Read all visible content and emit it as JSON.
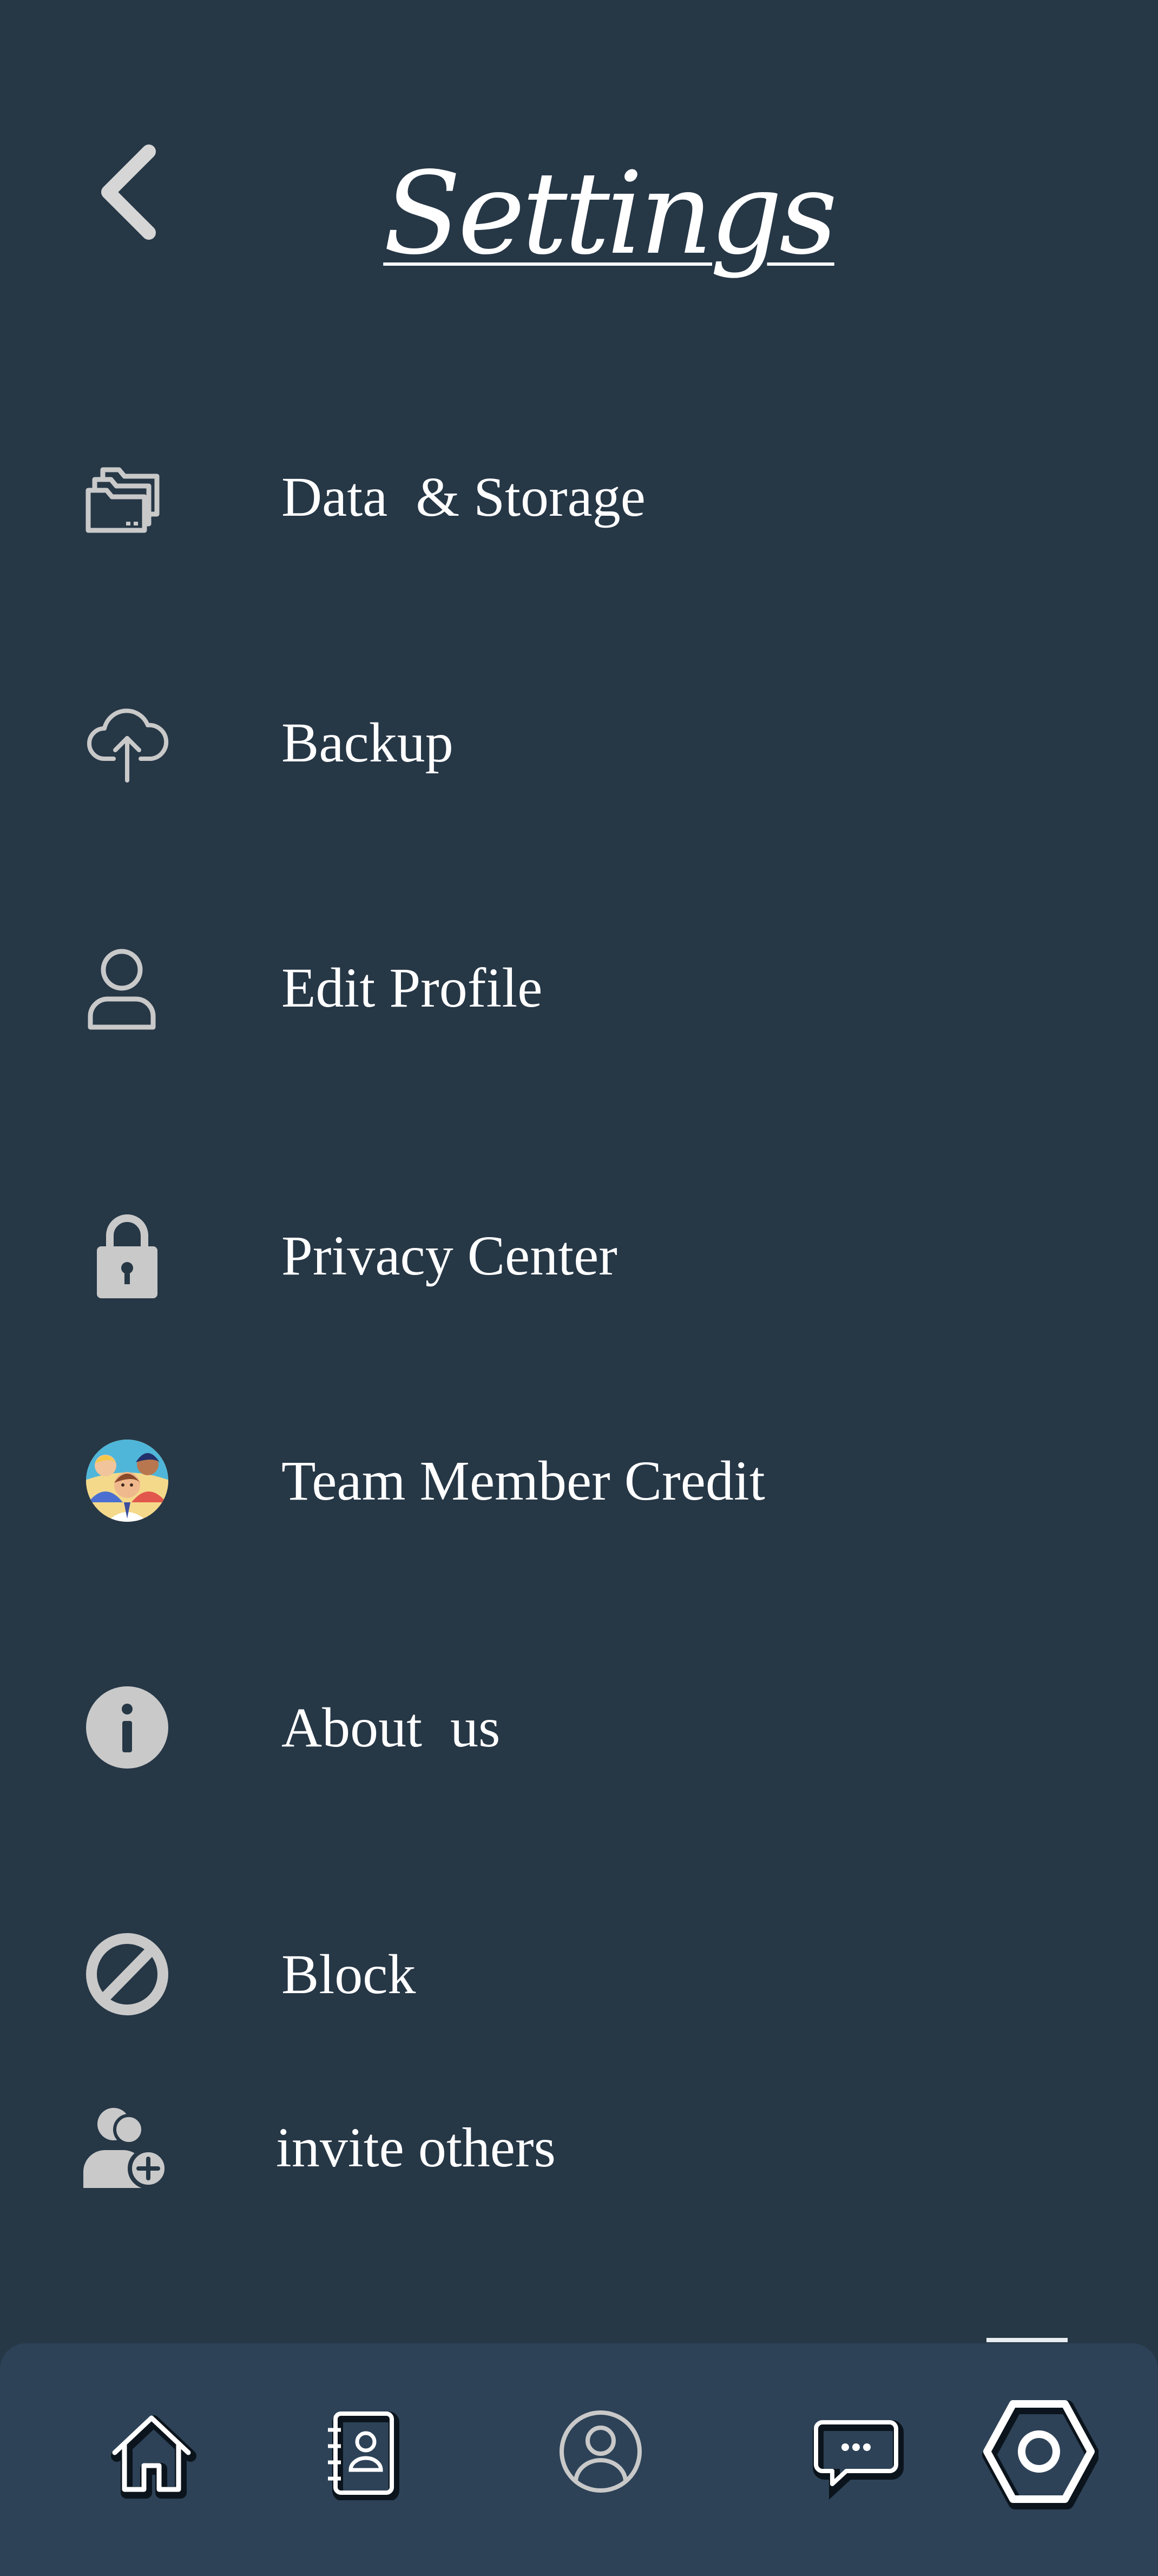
{
  "header": {
    "title": "Settings",
    "back_icon": "chevron-left-icon"
  },
  "menu": {
    "items": [
      {
        "label": "Data  & Storage",
        "icon": "folders-icon"
      },
      {
        "label": "Backup",
        "icon": "cloud-upload-icon"
      },
      {
        "label": "Edit Profile",
        "icon": "user-icon"
      },
      {
        "label": "Privacy Center",
        "icon": "lock-icon"
      },
      {
        "label": "Team Member Credit",
        "icon": "team-avatar-icon"
      },
      {
        "label": "About  us",
        "icon": "info-icon"
      },
      {
        "label": "Block",
        "icon": "block-icon"
      },
      {
        "label": "invite others",
        "icon": "add-user-icon"
      }
    ]
  },
  "bottom_nav": {
    "items": [
      {
        "icon": "home-icon"
      },
      {
        "icon": "contacts-book-icon"
      },
      {
        "icon": "profile-icon"
      },
      {
        "icon": "chat-icon"
      },
      {
        "icon": "settings-hexagon-icon",
        "active": true
      }
    ]
  },
  "colors": {
    "background": "#263746",
    "nav_background": "#2d4257",
    "icon_gray": "#c9c9c9",
    "text": "#ffffff"
  }
}
